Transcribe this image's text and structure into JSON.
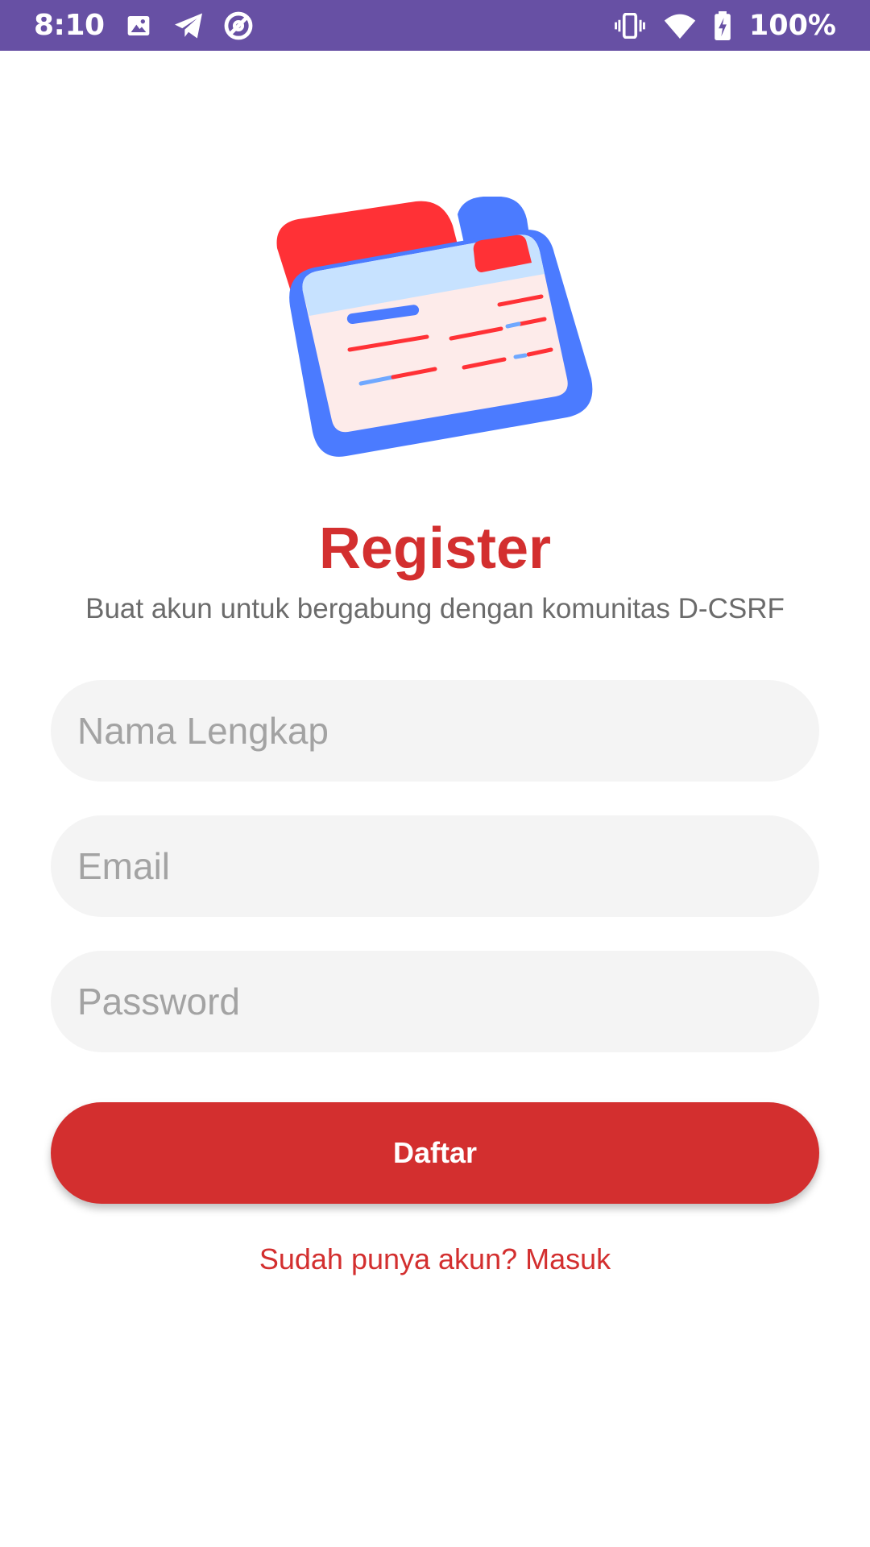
{
  "status_bar": {
    "time": "8:10",
    "left_icons": [
      "image-icon",
      "telegram-icon",
      "at-sign-icon"
    ],
    "right_icons": [
      "vibrate-icon",
      "wifi-icon",
      "battery-charging-icon"
    ],
    "battery": "100%",
    "background_color": "#6750A4"
  },
  "header": {
    "illustration": "folder-cards-illustration",
    "title": "Register",
    "subtitle": "Buat akun untuk bergabung dengan komunitas D-CSRF"
  },
  "form": {
    "name_placeholder": "Nama Lengkap",
    "email_placeholder": "Email",
    "password_placeholder": "Password",
    "submit_label": "Daftar"
  },
  "footer": {
    "login_link": "Sudah punya akun? Masuk"
  },
  "colors": {
    "accent": "#D32F2F",
    "field_bg": "#F4F4F4"
  }
}
